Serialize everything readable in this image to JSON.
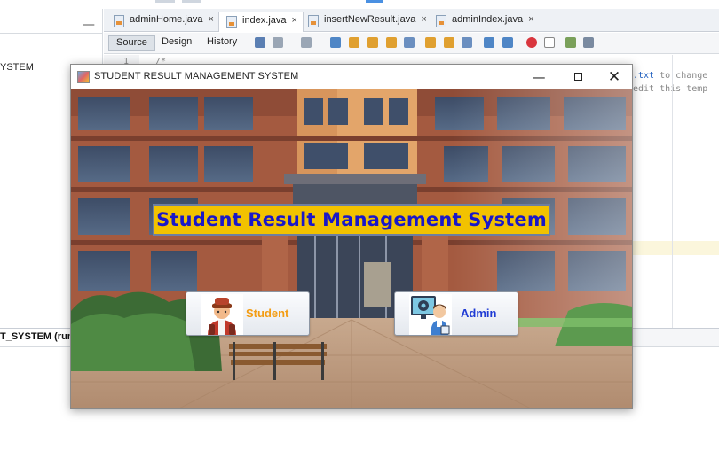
{
  "ide": {
    "left_panel": {
      "row_text": "YSTEM",
      "bottom_text": "T_SYSTEM (run)"
    },
    "tabs": [
      {
        "label": "adminHome.java",
        "active": false
      },
      {
        "label": "index.java",
        "active": true
      },
      {
        "label": "insertNewResult.java",
        "active": false
      },
      {
        "label": "adminIndex.java",
        "active": false
      }
    ],
    "close_glyph": "×",
    "toolbar": {
      "source_label": "Source",
      "design_label": "Design",
      "history_label": "History"
    },
    "editor": {
      "line_number": "1",
      "line1_code": "/*",
      "line1_right_link": ".txt",
      "line1_right_text": " to change",
      "line2_right_text": "edit this temp"
    }
  },
  "app_window": {
    "title": "STUDENT RESULT MANAGEMENT SYSTEM",
    "controls": {
      "minimize": "—",
      "close": "✕"
    },
    "banner_text": "Student Result Management System",
    "buttons": {
      "student_label": "Student",
      "admin_label": "Admin"
    },
    "colors": {
      "banner_bg": "#f2c200",
      "banner_text": "#1a18c8",
      "student_label": "#f39c12",
      "admin_label": "#1f3bd4"
    },
    "icons": {
      "student": "student-avatar-icon",
      "admin": "admin-monitor-icon",
      "app": "java-app-icon"
    }
  }
}
